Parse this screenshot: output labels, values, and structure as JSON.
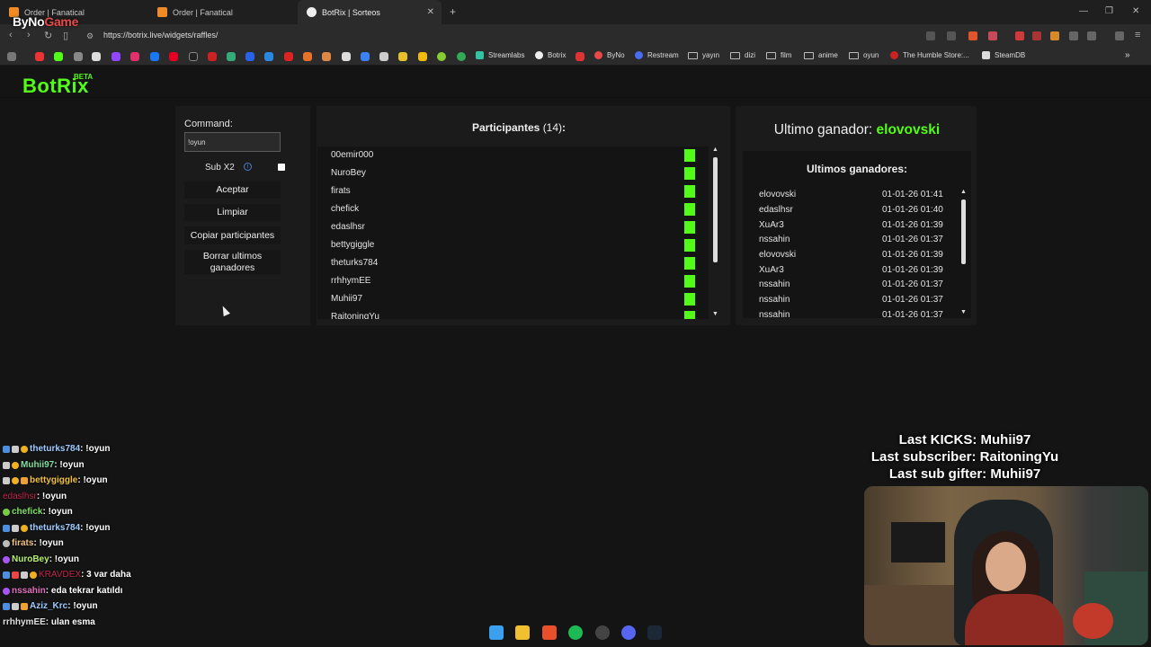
{
  "browser": {
    "tabs": [
      {
        "title": "Order | Fanatical",
        "active": false
      },
      {
        "title": "Order | Fanatical",
        "active": false
      },
      {
        "title": "BotRix | Sorteos",
        "active": true
      }
    ],
    "url": "https://botrix.live/widgets/raffles/",
    "bookmarks": [
      "Streamlabs",
      "Botrix",
      "ByNo",
      "Restream",
      "yayın",
      "dizi",
      "film",
      "anime",
      "oyun",
      "The Humble Store:...",
      "SteamDB"
    ]
  },
  "overlay": {
    "logo_prefix": "ByNo",
    "logo_suffix": "Game",
    "alerts": {
      "last_kicks": "Last KICKS: Muhii97",
      "last_sub": "Last subscriber: RaitoningYu",
      "last_gifter": "Last sub gifter: Muhii97"
    },
    "chat": [
      {
        "user": "theturks784",
        "msg": " : !oyun",
        "color": "#9ecbff"
      },
      {
        "user": "Muhii97",
        "msg": " : !oyun",
        "color": "#7fe0a0"
      },
      {
        "user": "bettygiggle",
        "msg": " : !oyun",
        "color": "#f0c040"
      },
      {
        "user": "edaslhsr",
        "msg": " : !oyun",
        "color": "#c0264a"
      },
      {
        "user": "chefick",
        "msg": " : !oyun",
        "color": "#7fe060"
      },
      {
        "user": "theturks784",
        "msg": " : !oyun",
        "color": "#9ecbff"
      },
      {
        "user": "firats",
        "msg": " : !oyun",
        "color": "#f0c080"
      },
      {
        "user": "NuroBey",
        "msg": " : !oyun",
        "color": "#b8f070"
      },
      {
        "user": "KRAVDEX",
        "msg": " : 3 var daha",
        "color": "#c0264a"
      },
      {
        "user": "nssahin",
        "msg": " : eda tekrar katıldı",
        "color": "#e070c0"
      },
      {
        "user": "Aziz_Krc",
        "msg": " : !oyun",
        "color": "#9ecbff"
      },
      {
        "user": "rrhhymEE",
        "msg": " : ulan esma",
        "color": "#e0e0e0"
      }
    ]
  },
  "app": {
    "logo": "BotRix",
    "beta": "BETA",
    "controls": {
      "command_label": "Command:",
      "command_value": "!oyun",
      "sub_label": "Sub X2",
      "sub_checked": false,
      "accept": "Aceptar",
      "clear": "Limpiar",
      "copy": "Copiar participantes",
      "delete_winners": "Borrar ultimos ganadores"
    },
    "participants": {
      "title": "Participantes",
      "count": "(14)",
      "colon": ":",
      "list": [
        "00emir000",
        "NuroBey",
        "firats",
        "chefick",
        "edaslhsr",
        "bettygiggle",
        "theturks784",
        "rrhhymEE",
        "Muhii97",
        "RaitoningYu"
      ]
    },
    "winners": {
      "last_label": "Ultimo ganador:",
      "last_name": "elovovski",
      "title": "Ultimos ganadores:",
      "list": [
        {
          "name": "elovovski",
          "date": "01-01-26 01:41"
        },
        {
          "name": "edaslhsr",
          "date": "01-01-26 01:40"
        },
        {
          "name": "XuAr3",
          "date": "01-01-26 01:39"
        },
        {
          "name": "nssahin",
          "date": "01-01-26 01:37"
        },
        {
          "name": "elovovski",
          "date": "01-01-26 01:39"
        },
        {
          "name": "XuAr3",
          "date": "01-01-26 01:39"
        },
        {
          "name": "nssahin",
          "date": "01-01-26 01:37"
        },
        {
          "name": "nssahin",
          "date": "01-01-26 01:37"
        },
        {
          "name": "nssahin",
          "date": "01-01-26 01:37"
        }
      ]
    }
  }
}
